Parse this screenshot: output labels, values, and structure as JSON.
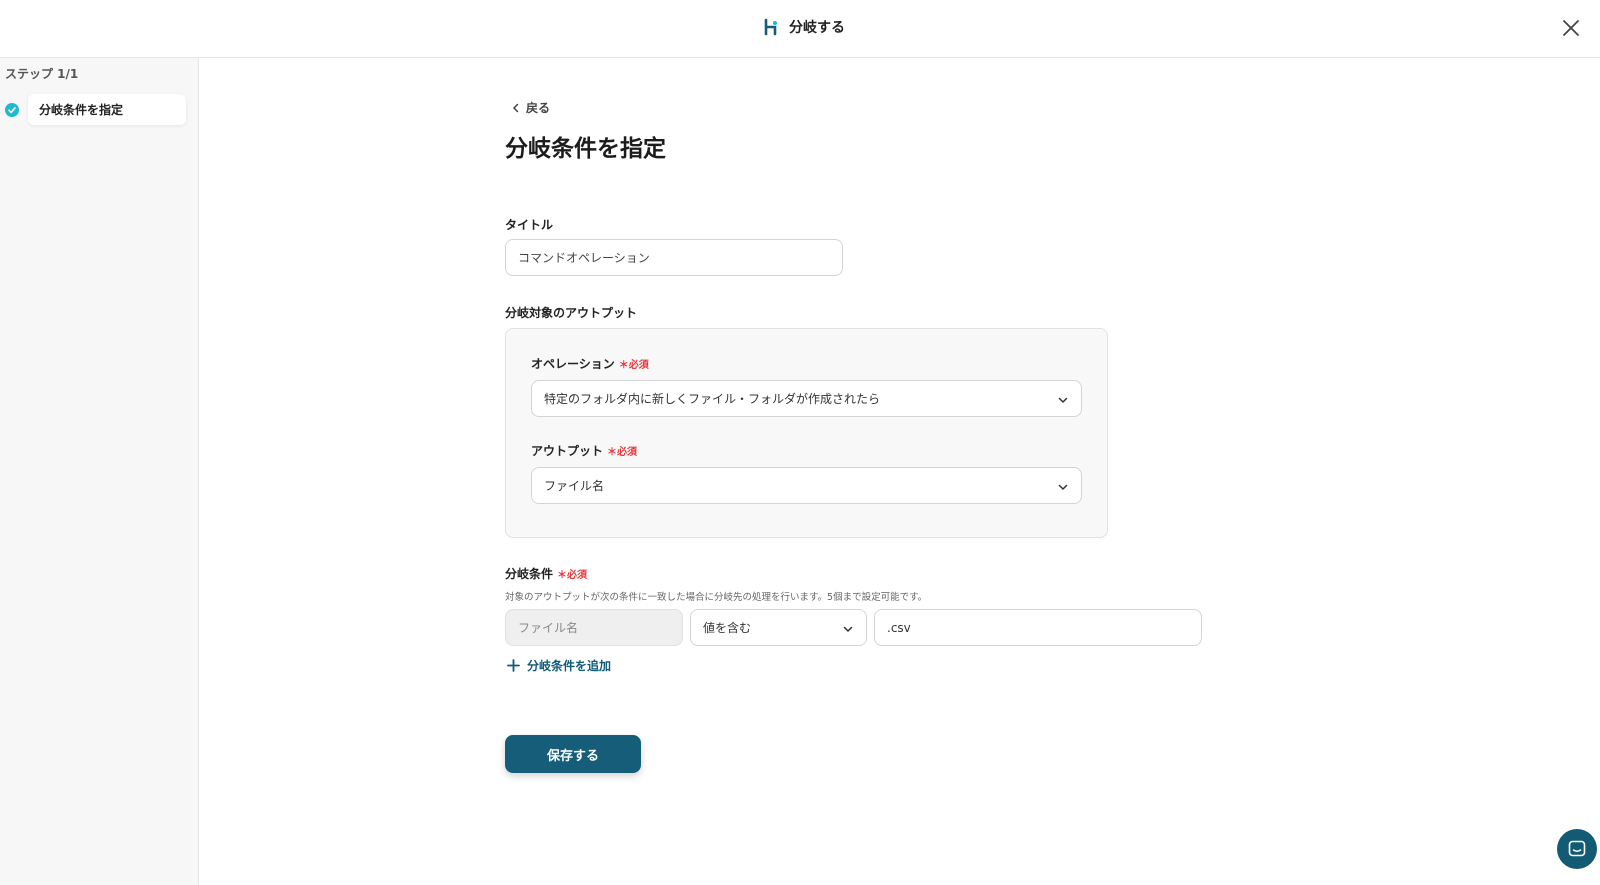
{
  "header": {
    "title": "分岐する",
    "icon": "branch-icon",
    "close_icon": "close-icon"
  },
  "sidebar": {
    "step_label": "ステップ 1/1",
    "steps": [
      {
        "label": "分岐条件を指定",
        "status": "complete"
      }
    ]
  },
  "main": {
    "back_label": "戻る",
    "page_title": "分岐条件を指定",
    "title_field": {
      "label": "タイトル",
      "value": "コマンドオペレーション"
    },
    "output_section": {
      "label": "分岐対象のアウトプット",
      "operation": {
        "label": "オペレーション",
        "required": "必須",
        "value": "特定のフォルダ内に新しくファイル・フォルダが作成されたら"
      },
      "output": {
        "label": "アウトプット",
        "required": "必須",
        "value": "ファイル名"
      }
    },
    "conditions": {
      "label": "分岐条件",
      "required": "必須",
      "hint": "対象のアウトプットが次の条件に一致した場合に分岐先の処理を行います。5個まで設定可能です。",
      "rows": [
        {
          "field": "ファイル名",
          "operator": "値を含む",
          "value": ".csv"
        }
      ],
      "add_label": "分岐条件を追加"
    },
    "save_label": "保存する"
  },
  "colors": {
    "primary": "#155d79",
    "required": "#e8383d",
    "check": "#21b8d1"
  }
}
